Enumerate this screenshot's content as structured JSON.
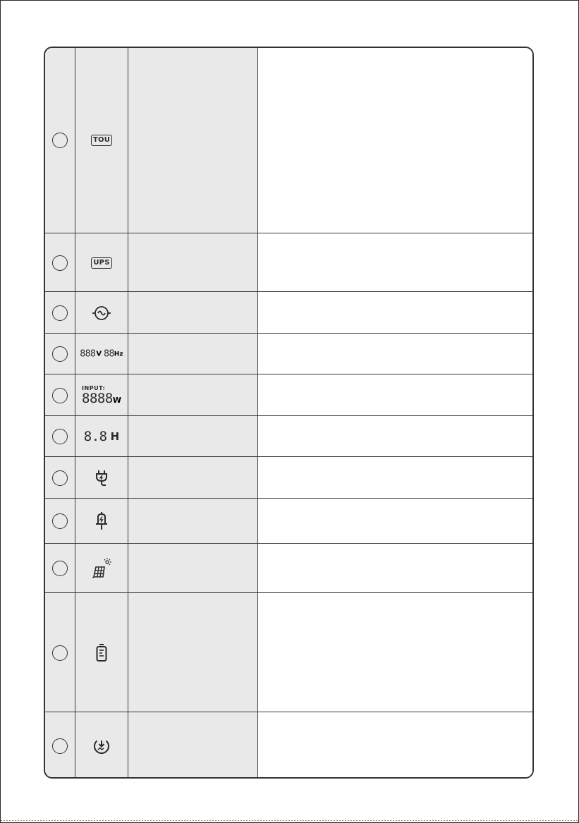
{
  "rows": [
    {
      "icon": "tou-badge-icon",
      "label": "TOU"
    },
    {
      "icon": "ups-badge-icon",
      "label": "UPS"
    },
    {
      "icon": "ac-sine-wave-icon"
    },
    {
      "icon": "voltage-frequency-display-icon",
      "voltage_digits": "888",
      "voltage_unit": "V",
      "frequency_digits": "88",
      "frequency_unit": "Hz"
    },
    {
      "icon": "input-power-display-icon",
      "label": "INPUT:",
      "digits": "8888",
      "unit": "W"
    },
    {
      "icon": "hours-display-icon",
      "digits": "8.8",
      "unit": "H"
    },
    {
      "icon": "ac-plug-charging-icon"
    },
    {
      "icon": "car-charging-icon"
    },
    {
      "icon": "solar-panel-icon"
    },
    {
      "icon": "battery-level-icon"
    },
    {
      "icon": "download-update-icon"
    }
  ]
}
